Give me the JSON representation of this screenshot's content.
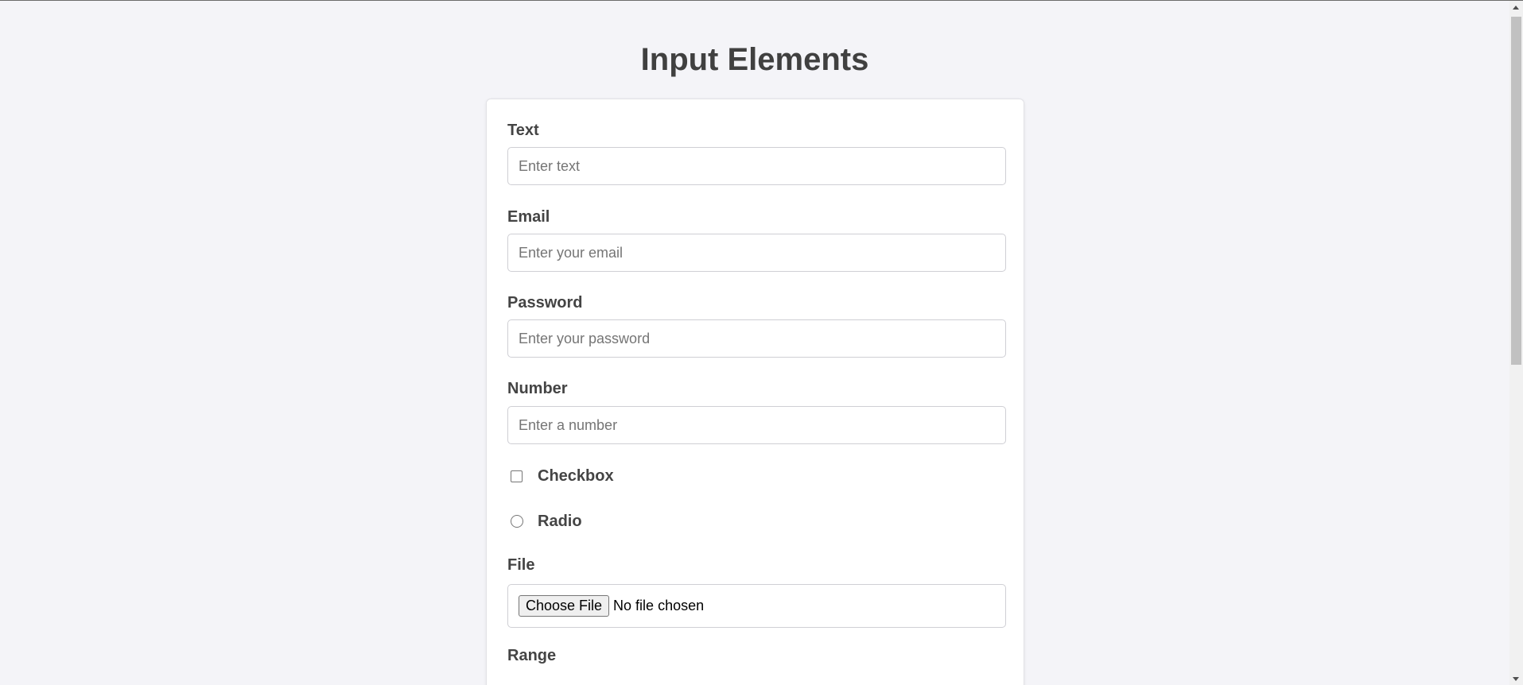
{
  "page": {
    "title": "Input Elements"
  },
  "form": {
    "text": {
      "label": "Text",
      "placeholder": "Enter text",
      "value": ""
    },
    "email": {
      "label": "Email",
      "placeholder": "Enter your email",
      "value": ""
    },
    "password": {
      "label": "Password",
      "placeholder": "Enter your password",
      "value": ""
    },
    "number": {
      "label": "Number",
      "placeholder": "Enter a number",
      "value": ""
    },
    "checkbox": {
      "label": "Checkbox",
      "checked": false
    },
    "radio": {
      "label": "Radio",
      "checked": false
    },
    "file": {
      "label": "File",
      "button_label": "Choose File",
      "status": "No file chosen"
    },
    "range": {
      "label": "Range"
    }
  },
  "colors": {
    "page_background": "#f4f4f8",
    "card_background": "#ffffff",
    "text": "#444444",
    "input_border": "#cfcfd4"
  }
}
